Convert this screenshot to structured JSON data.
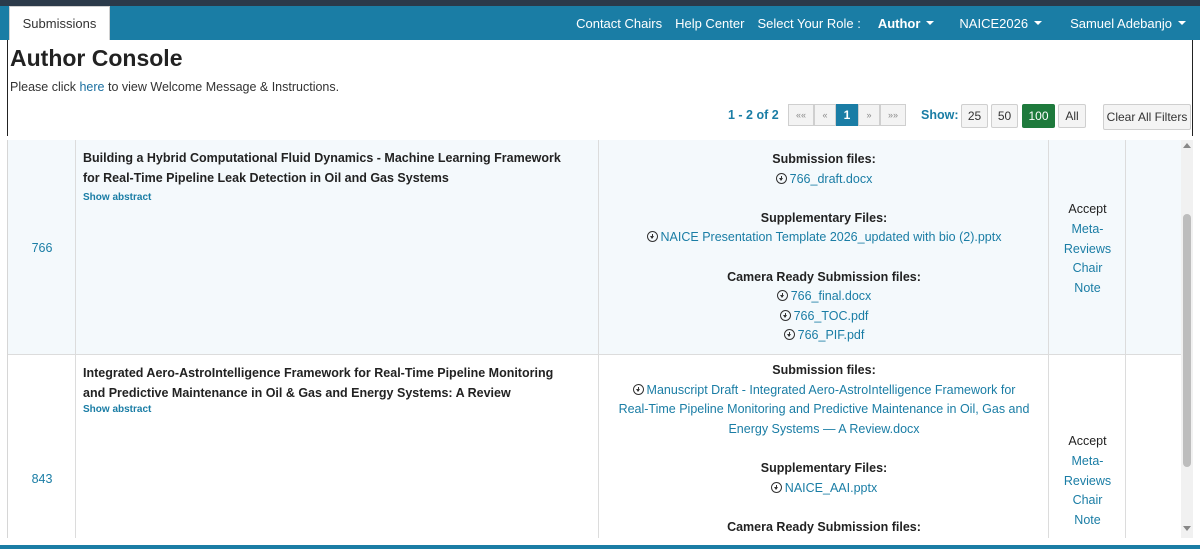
{
  "nav": {
    "submissions_tab": "Submissions",
    "contact_chairs": "Contact Chairs",
    "help_center": "Help Center",
    "select_role_label": "Select Your Role :",
    "role": "Author",
    "conference": "NAICE2026",
    "user": "Samuel Adebanjo"
  },
  "console": {
    "title": "Author Console",
    "welcome_before": "Please click ",
    "welcome_link": "here",
    "welcome_after": " to view Welcome Message & Instructions."
  },
  "pager": {
    "range": "1 - 2 of 2",
    "first": "««",
    "prev": "«",
    "current": "1",
    "next": "»",
    "last": "»»",
    "show_label": "Show:",
    "sizes": [
      "25",
      "50",
      "100",
      "All"
    ],
    "active_size": "100",
    "clear_filters": "Clear All Filters"
  },
  "submissions": [
    {
      "id": "766",
      "title_line1": "Building a Hybrid Computational Fluid Dynamics - Machine Learning Framework",
      "title_line2": "for Real-Time Pipeline Leak Detection in Oil and Gas Systems",
      "show_abstract": "Show abstract",
      "submission_files_label": "Submission files:",
      "submission_files": [
        "766_draft.docx"
      ],
      "supplementary_label": "Supplementary Files:",
      "supplementary_files": [
        "NAICE Presentation Template 2026_updated with bio (2).pptx"
      ],
      "camera_ready_label": "Camera Ready Submission files:",
      "camera_ready_files": [
        "766_final.docx",
        "766_TOC.pdf",
        "766_PIF.pdf"
      ],
      "status": "Accept",
      "meta_line1": "Meta-",
      "meta_line2": "Reviews",
      "chair_note_line1": "Chair",
      "chair_note_line2": "Note"
    },
    {
      "id": "843",
      "title_line1": "Integrated Aero-AstroIntelligence Framework for Real-Time Pipeline Monitoring",
      "title_line2": "and Predictive Maintenance in Oil & Gas and Energy Systems: A Review",
      "show_abstract": "Show abstract",
      "submission_files_label": "Submission files:",
      "submission_file_line1": "Manuscript Draft - Integrated Aero-AstroIntelligence Framework for",
      "submission_file_line2": "Real-Time Pipeline Monitoring and Predictive Maintenance in Oil, Gas and",
      "submission_file_line3": "Energy Systems — A Review.docx",
      "supplementary_label": "Supplementary Files:",
      "supplementary_files": [
        "NAICE_AAI.pptx"
      ],
      "camera_ready_label": "Camera Ready Submission files:",
      "status": "Accept",
      "meta_line1": "Meta-",
      "meta_line2": "Reviews",
      "chair_note_line1": "Chair",
      "chair_note_line2": "Note"
    }
  ],
  "colors": {
    "navbar": "#1a7da5",
    "link": "#1a7da5",
    "active_size": "#1e7a3c",
    "row_highlight": "#f4f9fc"
  }
}
